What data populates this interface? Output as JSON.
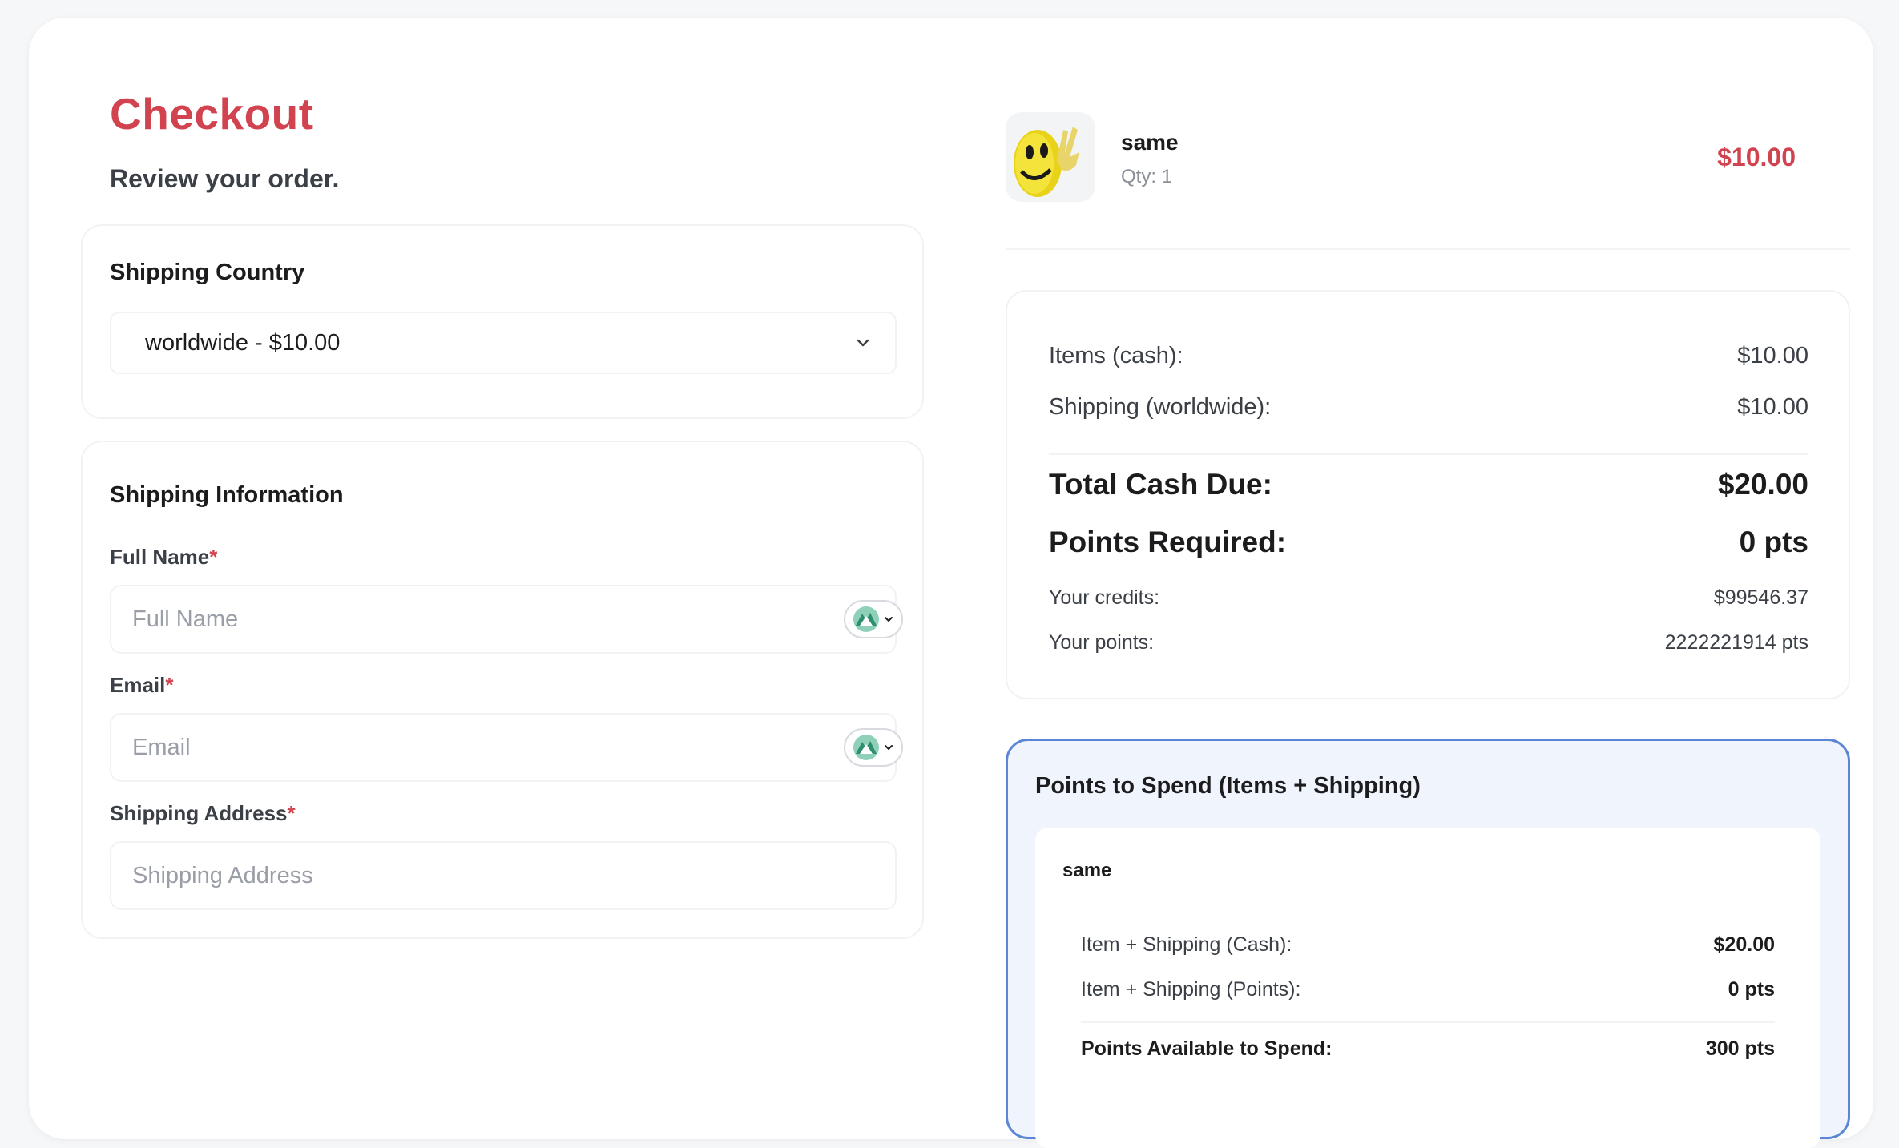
{
  "header": {
    "title": "Checkout",
    "subtitle": "Review your order."
  },
  "shipping_country": {
    "title": "Shipping Country",
    "selected": "worldwide - $10.00"
  },
  "shipping_info": {
    "title": "Shipping Information",
    "required_mark": "*",
    "full_name": {
      "label": "Full Name",
      "placeholder": "Full Name",
      "value": ""
    },
    "email": {
      "label": "Email",
      "placeholder": "Email",
      "value": ""
    },
    "address": {
      "label": "Shipping Address",
      "placeholder": "Shipping Address",
      "value": ""
    }
  },
  "order_item": {
    "name": "same",
    "qty": "Qty: 1",
    "price": "$10.00"
  },
  "summary": {
    "items_label": "Items (cash):",
    "items_value": "$10.00",
    "shipping_label": "Shipping (worldwide):",
    "shipping_value": "$10.00",
    "total_label": "Total Cash Due:",
    "total_value": "$20.00",
    "points_label": "Points Required:",
    "points_value": "0 pts",
    "credits_label": "Your credits:",
    "credits_value": "$99546.37",
    "your_points_label": "Your points:",
    "your_points_value": "2222221914 pts"
  },
  "points_spend": {
    "title": "Points to Spend (Items + Shipping)",
    "item_name": "same",
    "cash_label": "Item + Shipping (Cash):",
    "cash_value": "$20.00",
    "points_label": "Item + Shipping (Points):",
    "points_value": "0 pts",
    "available_label": "Points Available to Spend:",
    "available_value": "300 pts"
  },
  "colors": {
    "accent": "#d1434f",
    "spend_border": "#5b86d6",
    "spend_bg": "#f0f4fc"
  },
  "icons": {
    "dropdown": "chevron-down-icon",
    "autofill": "autofill-extension-icon",
    "product": "smiley-thumbnail"
  }
}
